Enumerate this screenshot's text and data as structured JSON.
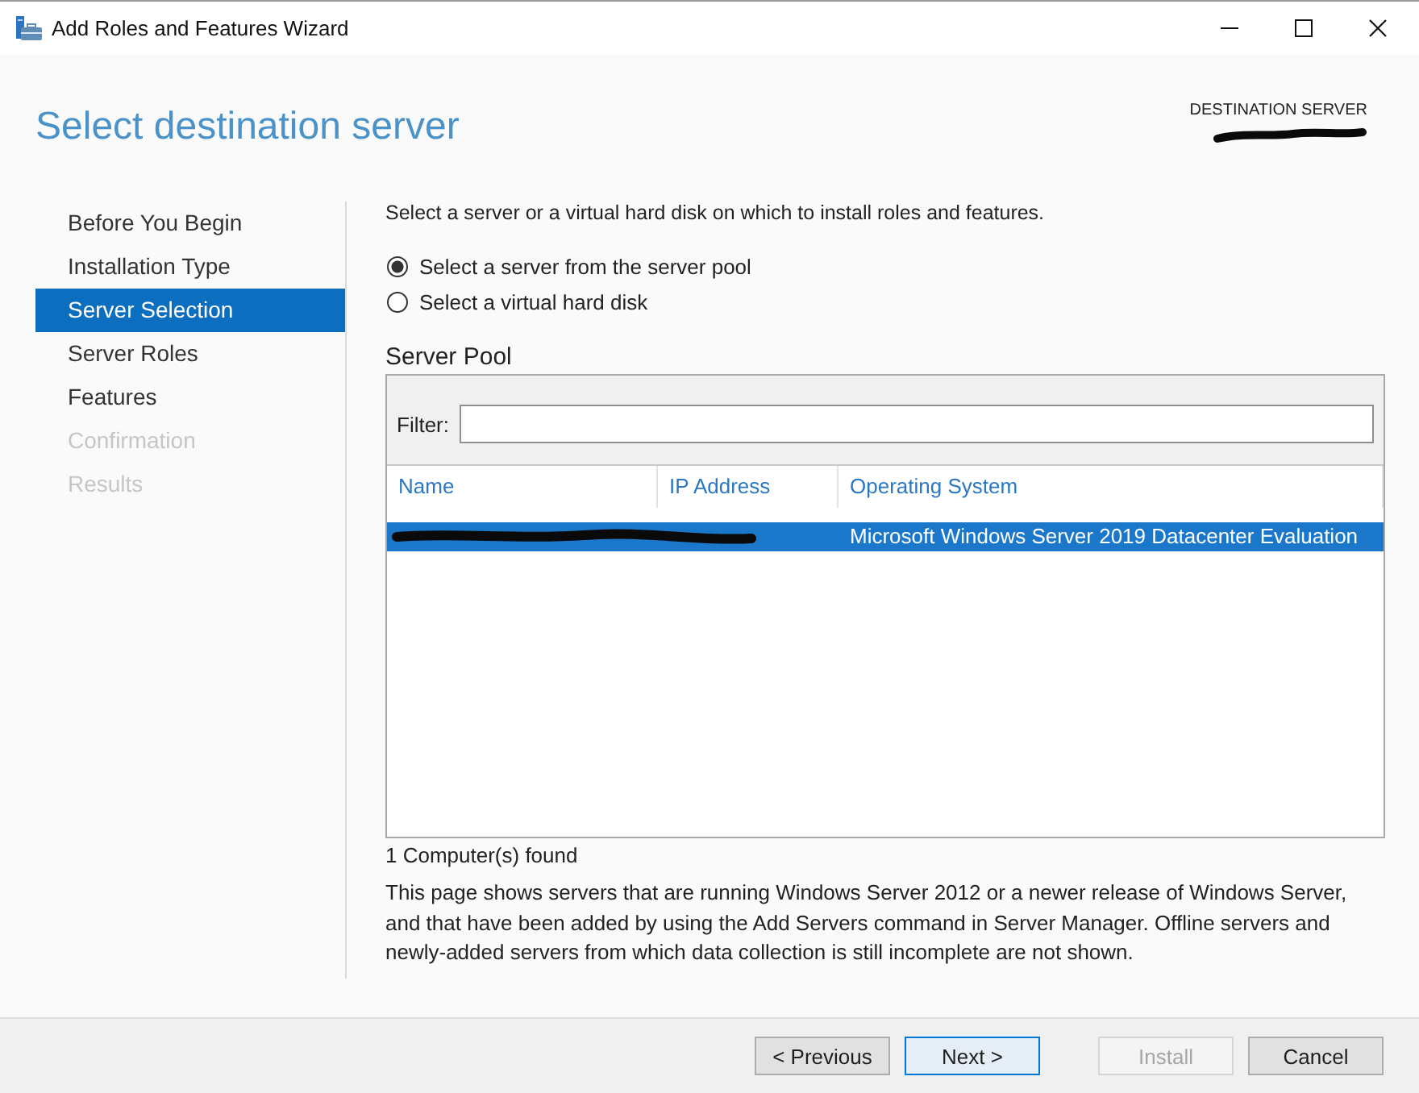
{
  "window": {
    "title": "Add Roles and Features Wizard"
  },
  "header": {
    "title": "Select destination server",
    "destination": {
      "label": "DESTINATION SERVER",
      "redacted": true
    }
  },
  "steps": [
    {
      "label": "Before You Begin",
      "selected": false,
      "disabled": false
    },
    {
      "label": "Installation Type",
      "selected": false,
      "disabled": false
    },
    {
      "label": "Server Selection",
      "selected": true,
      "disabled": false
    },
    {
      "label": "Server Roles",
      "selected": false,
      "disabled": false
    },
    {
      "label": "Features",
      "selected": false,
      "disabled": false
    },
    {
      "label": "Confirmation",
      "selected": false,
      "disabled": true
    },
    {
      "label": "Results",
      "selected": false,
      "disabled": true
    }
  ],
  "instruction": "Select a server or a virtual hard disk on which to install roles and features.",
  "options": [
    {
      "label": "Select a server from the server pool",
      "selected": true
    },
    {
      "label": "Select a virtual hard disk",
      "selected": false
    }
  ],
  "server_pool": {
    "title": "Server Pool",
    "filter_label": "Filter:",
    "columns": [
      "Name",
      "IP Address",
      "Operating System"
    ],
    "rows": [
      {
        "selected": true,
        "redacted": true,
        "operating_system": "Microsoft Windows Server 2019 Datacenter Evaluation"
      }
    ]
  },
  "count": "1 Computer(s) found",
  "note": "This page shows servers that are running Windows Server 2012 or a newer release of Windows Server, and that have been added by using the Add Servers command in Server Manager. Offline servers and newly-added servers from which data collection is still incomplete are not shown.",
  "nav_buttons": [
    {
      "label": "< Previous",
      "default": false,
      "disabled": false
    },
    {
      "label": "Next >",
      "default": true,
      "disabled": false
    }
  ],
  "action_buttons": [
    {
      "label": "Install",
      "default": false,
      "disabled": true
    },
    {
      "label": "Cancel",
      "default": false,
      "disabled": false
    }
  ]
}
